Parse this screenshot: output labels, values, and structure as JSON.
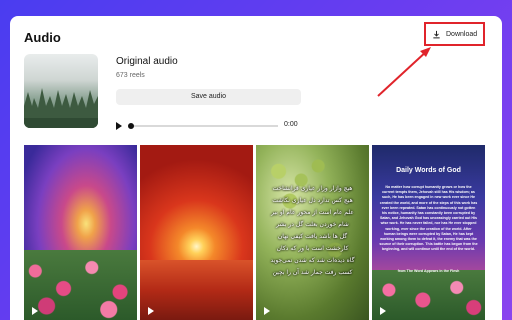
{
  "header": {
    "title": "Audio"
  },
  "toolbar": {
    "download_label": "Download"
  },
  "audio": {
    "name": "Original audio",
    "reels_count": "673 reels",
    "save_label": "Save audio",
    "time": "0:00"
  },
  "colors": {
    "highlight": "#e0242b",
    "background": "#5a3df0"
  },
  "reels": [
    {
      "description": ""
    },
    {
      "description": ""
    },
    {
      "poem_lines": [
        "هیچ وازار وزار عیاری فرانشاخت",
        "هیچ کس تدارد دل عیاری نکاشت",
        "علم عام است از محور عام او بیر",
        "شام خوردن بعلت گل در بشر",
        "گل ها باشد یافت کیفی نهان",
        "کارخشت است با ور که دکان",
        "گاه دیده‌ات شد که شدن نمی‌جوید",
        "کسب رفت جمار شد آن را بچین"
      ]
    },
    {
      "heading": "Daily Words of God",
      "body": "No matter how corrupt humanity grows or how the current tempts them, Jehovah still has His wisdom; as such, He has been engaged in new work ever since He created the world, and more of the steps of this work has ever been repeated. Satan has continuously not gotten his notice, humanity has constantly been corrupted by Satan, and Jehovah God has unceasingly carried out His wise work. He has never failed, nor has He ever stopped working, ever since the creation of the world. After human beings were corrupted by Satan, He has kept working among them to defeat it, the enemy that was the source of their corruption. This battle has begun from the beginning, and will continue until the end of the world.",
      "source": "from The Word Appears in the Flesh"
    }
  ]
}
